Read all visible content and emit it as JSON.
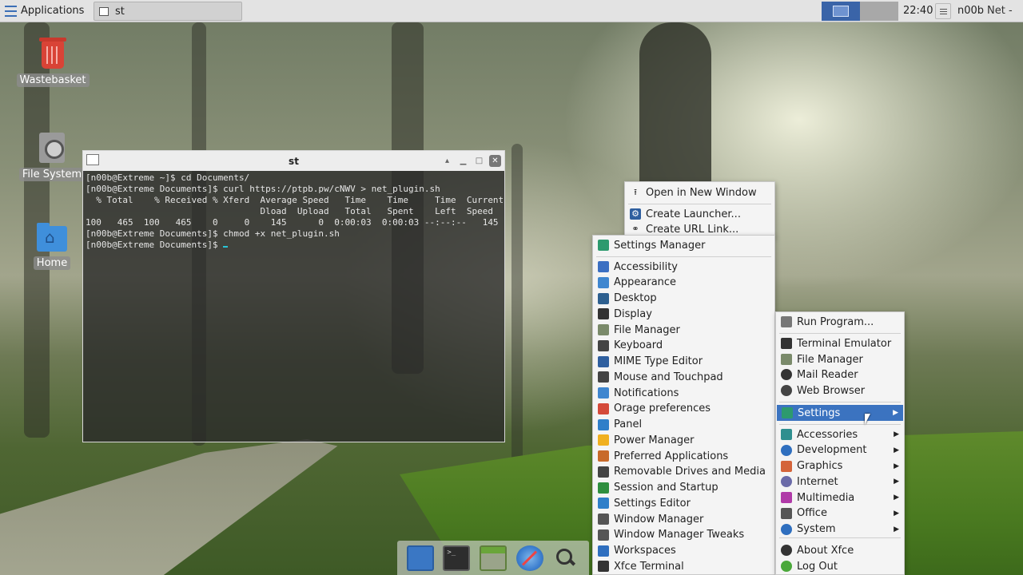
{
  "top_panel": {
    "applications_label": "Applications",
    "task_title": "st",
    "clock": "22:40",
    "user": "n00b",
    "net": "Net -"
  },
  "desktop_icons": [
    {
      "label": "Wastebasket",
      "icon": "trash-icon"
    },
    {
      "label": "File System",
      "icon": "drive-icon"
    },
    {
      "label": "Home",
      "icon": "home-folder-icon"
    }
  ],
  "terminal": {
    "title": "st",
    "lines": [
      "[n00b@Extreme ~]$ cd Documents/",
      "[n00b@Extreme Documents]$ curl https://ptpb.pw/cNWV > net_plugin.sh",
      "  % Total    % Received % Xferd  Average Speed   Time    Time     Time  Current",
      "                                 Dload  Upload   Total   Spent    Left  Speed",
      "100   465  100   465    0     0    145      0  0:00:03  0:00:03 --:--:--   145",
      "[n00b@Extreme Documents]$ chmod +x net_plugin.sh",
      "[n00b@Extreme Documents]$ "
    ]
  },
  "context_menu": {
    "items": [
      {
        "label": "Open in New Window",
        "icon": "open-window-icon"
      },
      {
        "label": "Create Launcher...",
        "icon": "gear-icon"
      },
      {
        "label": "Create URL Link...",
        "icon": "link-icon"
      }
    ]
  },
  "settings_menu": {
    "items": [
      {
        "label": "Settings Manager",
        "icon": "settings-manager-icon",
        "color": "#2d9a6e"
      },
      {
        "label": "Accessibility",
        "icon": "accessibility-icon",
        "color": "#3b6fc2"
      },
      {
        "label": "Appearance",
        "icon": "appearance-icon",
        "color": "#3f86cf"
      },
      {
        "label": "Desktop",
        "icon": "desktop-icon",
        "color": "#2d5f8f"
      },
      {
        "label": "Display",
        "icon": "display-icon",
        "color": "#333333"
      },
      {
        "label": "File Manager",
        "icon": "file-manager-icon",
        "color": "#7a8a6a"
      },
      {
        "label": "Keyboard",
        "icon": "keyboard-icon",
        "color": "#444444"
      },
      {
        "label": "MIME Type Editor",
        "icon": "mime-icon",
        "color": "#2f5f9f"
      },
      {
        "label": "Mouse and Touchpad",
        "icon": "mouse-icon",
        "color": "#444444"
      },
      {
        "label": "Notifications",
        "icon": "notifications-icon",
        "color": "#3f86cf"
      },
      {
        "label": "Orage preferences",
        "icon": "calendar-icon",
        "color": "#d44a3a"
      },
      {
        "label": "Panel",
        "icon": "panel-icon",
        "color": "#2f7fc9"
      },
      {
        "label": "Power Manager",
        "icon": "power-icon",
        "color": "#f0b020"
      },
      {
        "label": "Preferred Applications",
        "icon": "star-icon",
        "color": "#c86a2a"
      },
      {
        "label": "Removable Drives and Media",
        "icon": "removable-drive-icon",
        "color": "#444444"
      },
      {
        "label": "Session and Startup",
        "icon": "session-icon",
        "color": "#2f8f3f"
      },
      {
        "label": "Settings Editor",
        "icon": "settings-editor-icon",
        "color": "#2f7fc9"
      },
      {
        "label": "Window Manager",
        "icon": "window-manager-icon",
        "color": "#555555"
      },
      {
        "label": "Window Manager Tweaks",
        "icon": "window-tweaks-icon",
        "color": "#555555"
      },
      {
        "label": "Workspaces",
        "icon": "workspaces-icon",
        "color": "#2f6fbf"
      },
      {
        "label": "Xfce Terminal",
        "icon": "terminal-icon",
        "color": "#333333"
      }
    ]
  },
  "app_menu": {
    "top_items": [
      {
        "label": "Run Program...",
        "icon": "run-icon"
      },
      {
        "label": "Terminal Emulator",
        "icon": "terminal-icon"
      },
      {
        "label": "File Manager",
        "icon": "file-manager-icon"
      },
      {
        "label": "Mail Reader",
        "icon": "mail-icon"
      },
      {
        "label": "Web Browser",
        "icon": "web-browser-icon"
      }
    ],
    "settings_label": "Settings",
    "categories": [
      {
        "label": "Accessories",
        "icon": "accessories-icon",
        "color": "#2f8f8f"
      },
      {
        "label": "Development",
        "icon": "development-icon",
        "color": "#2f6fbf"
      },
      {
        "label": "Graphics",
        "icon": "graphics-icon",
        "color": "#d4643a"
      },
      {
        "label": "Internet",
        "icon": "internet-icon",
        "color": "#6a6aa8"
      },
      {
        "label": "Multimedia",
        "icon": "multimedia-icon",
        "color": "#b03aa8"
      },
      {
        "label": "Office",
        "icon": "office-icon",
        "color": "#555555"
      },
      {
        "label": "System",
        "icon": "system-icon",
        "color": "#2f6fbf"
      }
    ],
    "bottom_items": [
      {
        "label": "About Xfce",
        "icon": "info-icon"
      },
      {
        "label": "Log Out",
        "icon": "logout-icon"
      }
    ]
  },
  "dock": {
    "items": [
      {
        "icon": "show-desktop-icon"
      },
      {
        "icon": "terminal-icon"
      },
      {
        "icon": "file-manager-icon"
      },
      {
        "icon": "web-browser-icon"
      },
      {
        "icon": "search-icon"
      }
    ]
  }
}
